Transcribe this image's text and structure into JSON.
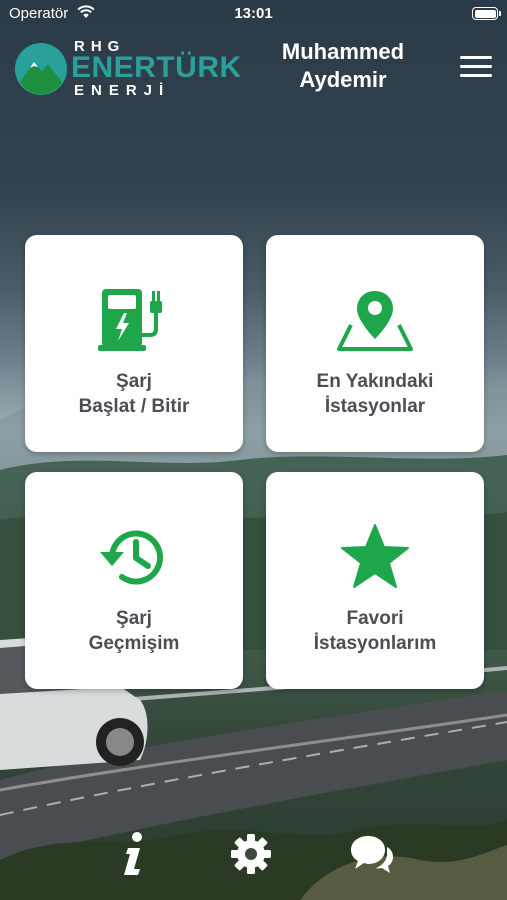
{
  "status_bar": {
    "carrier": "Operatör",
    "time": "13:01",
    "icons": [
      "wifi-icon",
      "battery-icon"
    ]
  },
  "header": {
    "logo": {
      "line1": "RHG",
      "line2": "ENERTÜRK",
      "line3": "ENERJİ"
    },
    "user_name": "Muhammed Aydemir",
    "menu_icon": "hamburger-menu-icon"
  },
  "cards": [
    {
      "icon": "ev-charger-icon",
      "line1": "Şarj",
      "line2": "Başlat / Bitir"
    },
    {
      "icon": "map-pin-icon",
      "line1": "En Yakındaki",
      "line2": "İstasyonlar"
    },
    {
      "icon": "history-clock-icon",
      "line1": "Şarj",
      "line2": "Geçmişim"
    },
    {
      "icon": "star-icon",
      "line1": "Favori",
      "line2": "İstasyonlarım"
    }
  ],
  "bottom_bar": {
    "icons": [
      "info-icon",
      "gear-icon",
      "chat-icon"
    ]
  },
  "colors": {
    "accent_green": "#1ea64a",
    "logo_teal": "#2aa09a",
    "card_text": "#4b4f55",
    "header_bg": "#2b3945"
  }
}
